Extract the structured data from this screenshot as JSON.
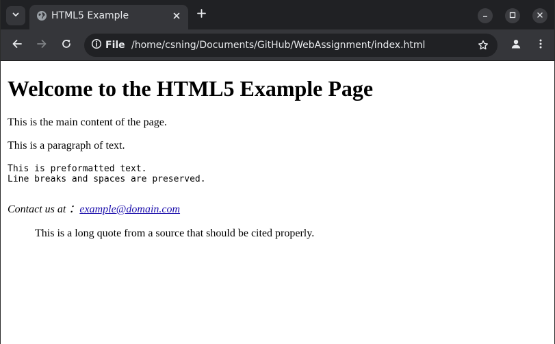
{
  "browser": {
    "tab": {
      "title": "HTML5 Example",
      "favicon_icon": "globe-icon"
    },
    "toolbar": {
      "site_info_label": "File",
      "url": "/home/csning/Documents/GitHub/WebAssignment/index.html"
    },
    "icons": {
      "tab_search": "chevron-down-icon",
      "tab_close": "close-icon",
      "new_tab": "plus-icon",
      "minimize": "minimize-icon",
      "maximize": "maximize-icon",
      "close_window": "close-icon",
      "back": "arrow-left-icon",
      "forward": "arrow-right-icon",
      "reload": "reload-icon",
      "site_info": "info-icon",
      "bookmark": "star-icon",
      "profile": "profile-icon",
      "menu": "kebab-menu-icon"
    },
    "colors": {
      "titlebar_bg": "#202124",
      "toolbar_bg": "#35363a",
      "omnibox_bg": "#202124",
      "text_light": "#e8eaed",
      "link": "#1a0dab"
    }
  },
  "page": {
    "heading": "Welcome to the HTML5 Example Page",
    "main_paragraph": "This is the main content of the page.",
    "text_paragraph": "This is a paragraph of text.",
    "preformatted": "This is preformatted text.\nLine breaks and spaces are preserved.",
    "contact_label": "Contact us at",
    "contact_separator": "：",
    "contact_email": "example@domain.com",
    "blockquote": "This is a long quote from a source that should be cited properly."
  }
}
